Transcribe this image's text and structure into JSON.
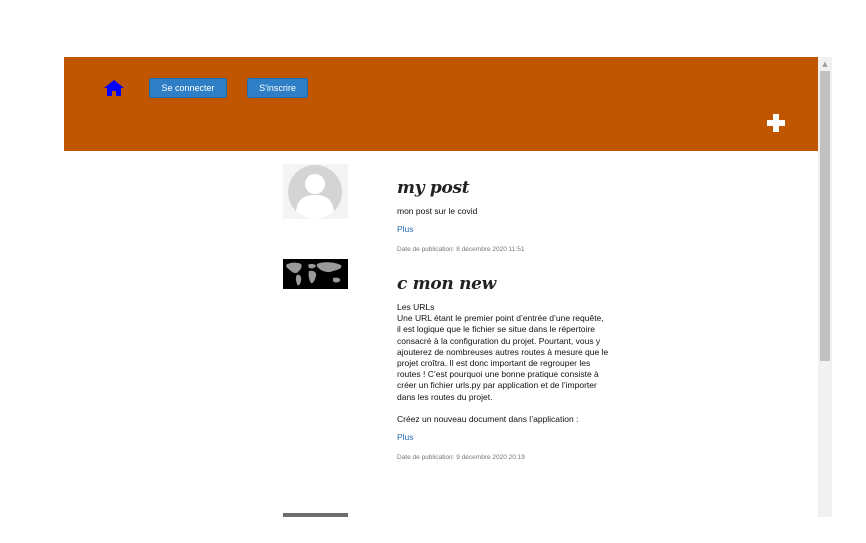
{
  "nav": {
    "home_icon": "home-icon",
    "login_label": "Se connecter",
    "signup_label": "S'inscrire",
    "add_icon": "plus-icon"
  },
  "colors": {
    "header": "#c05600",
    "button": "#2f7fc6",
    "link": "#2b6cb0",
    "home_icon": "#0000ff"
  },
  "posts": [
    {
      "thumbnail": "avatar-placeholder",
      "title": "my post",
      "text": "mon post sur le covid",
      "more_label": "Plus",
      "date": "Date de publication: 8 décembre 2020 11:51"
    },
    {
      "thumbnail": "world-map-image",
      "title": "c mon new",
      "text": "Les URLs\nUne URL étant le premier point d’entrée d’une requête, il est logique que le fichier se situe dans le répertoire consacré à la configuration du projet. Pourtant, vous y ajouterez de nombreuses autres routes à mesure que le projet croîtra. Il est donc important de regrouper les routes ! C’est pourquoi une bonne pratique consiste à créer un fichier urls.py par application et de l’importer dans les routes du projet.\n\nCréez un nouveau document dans l’application :",
      "more_label": "Plus",
      "date": "Date de publication: 9 décembre 2020 20:19"
    }
  ]
}
